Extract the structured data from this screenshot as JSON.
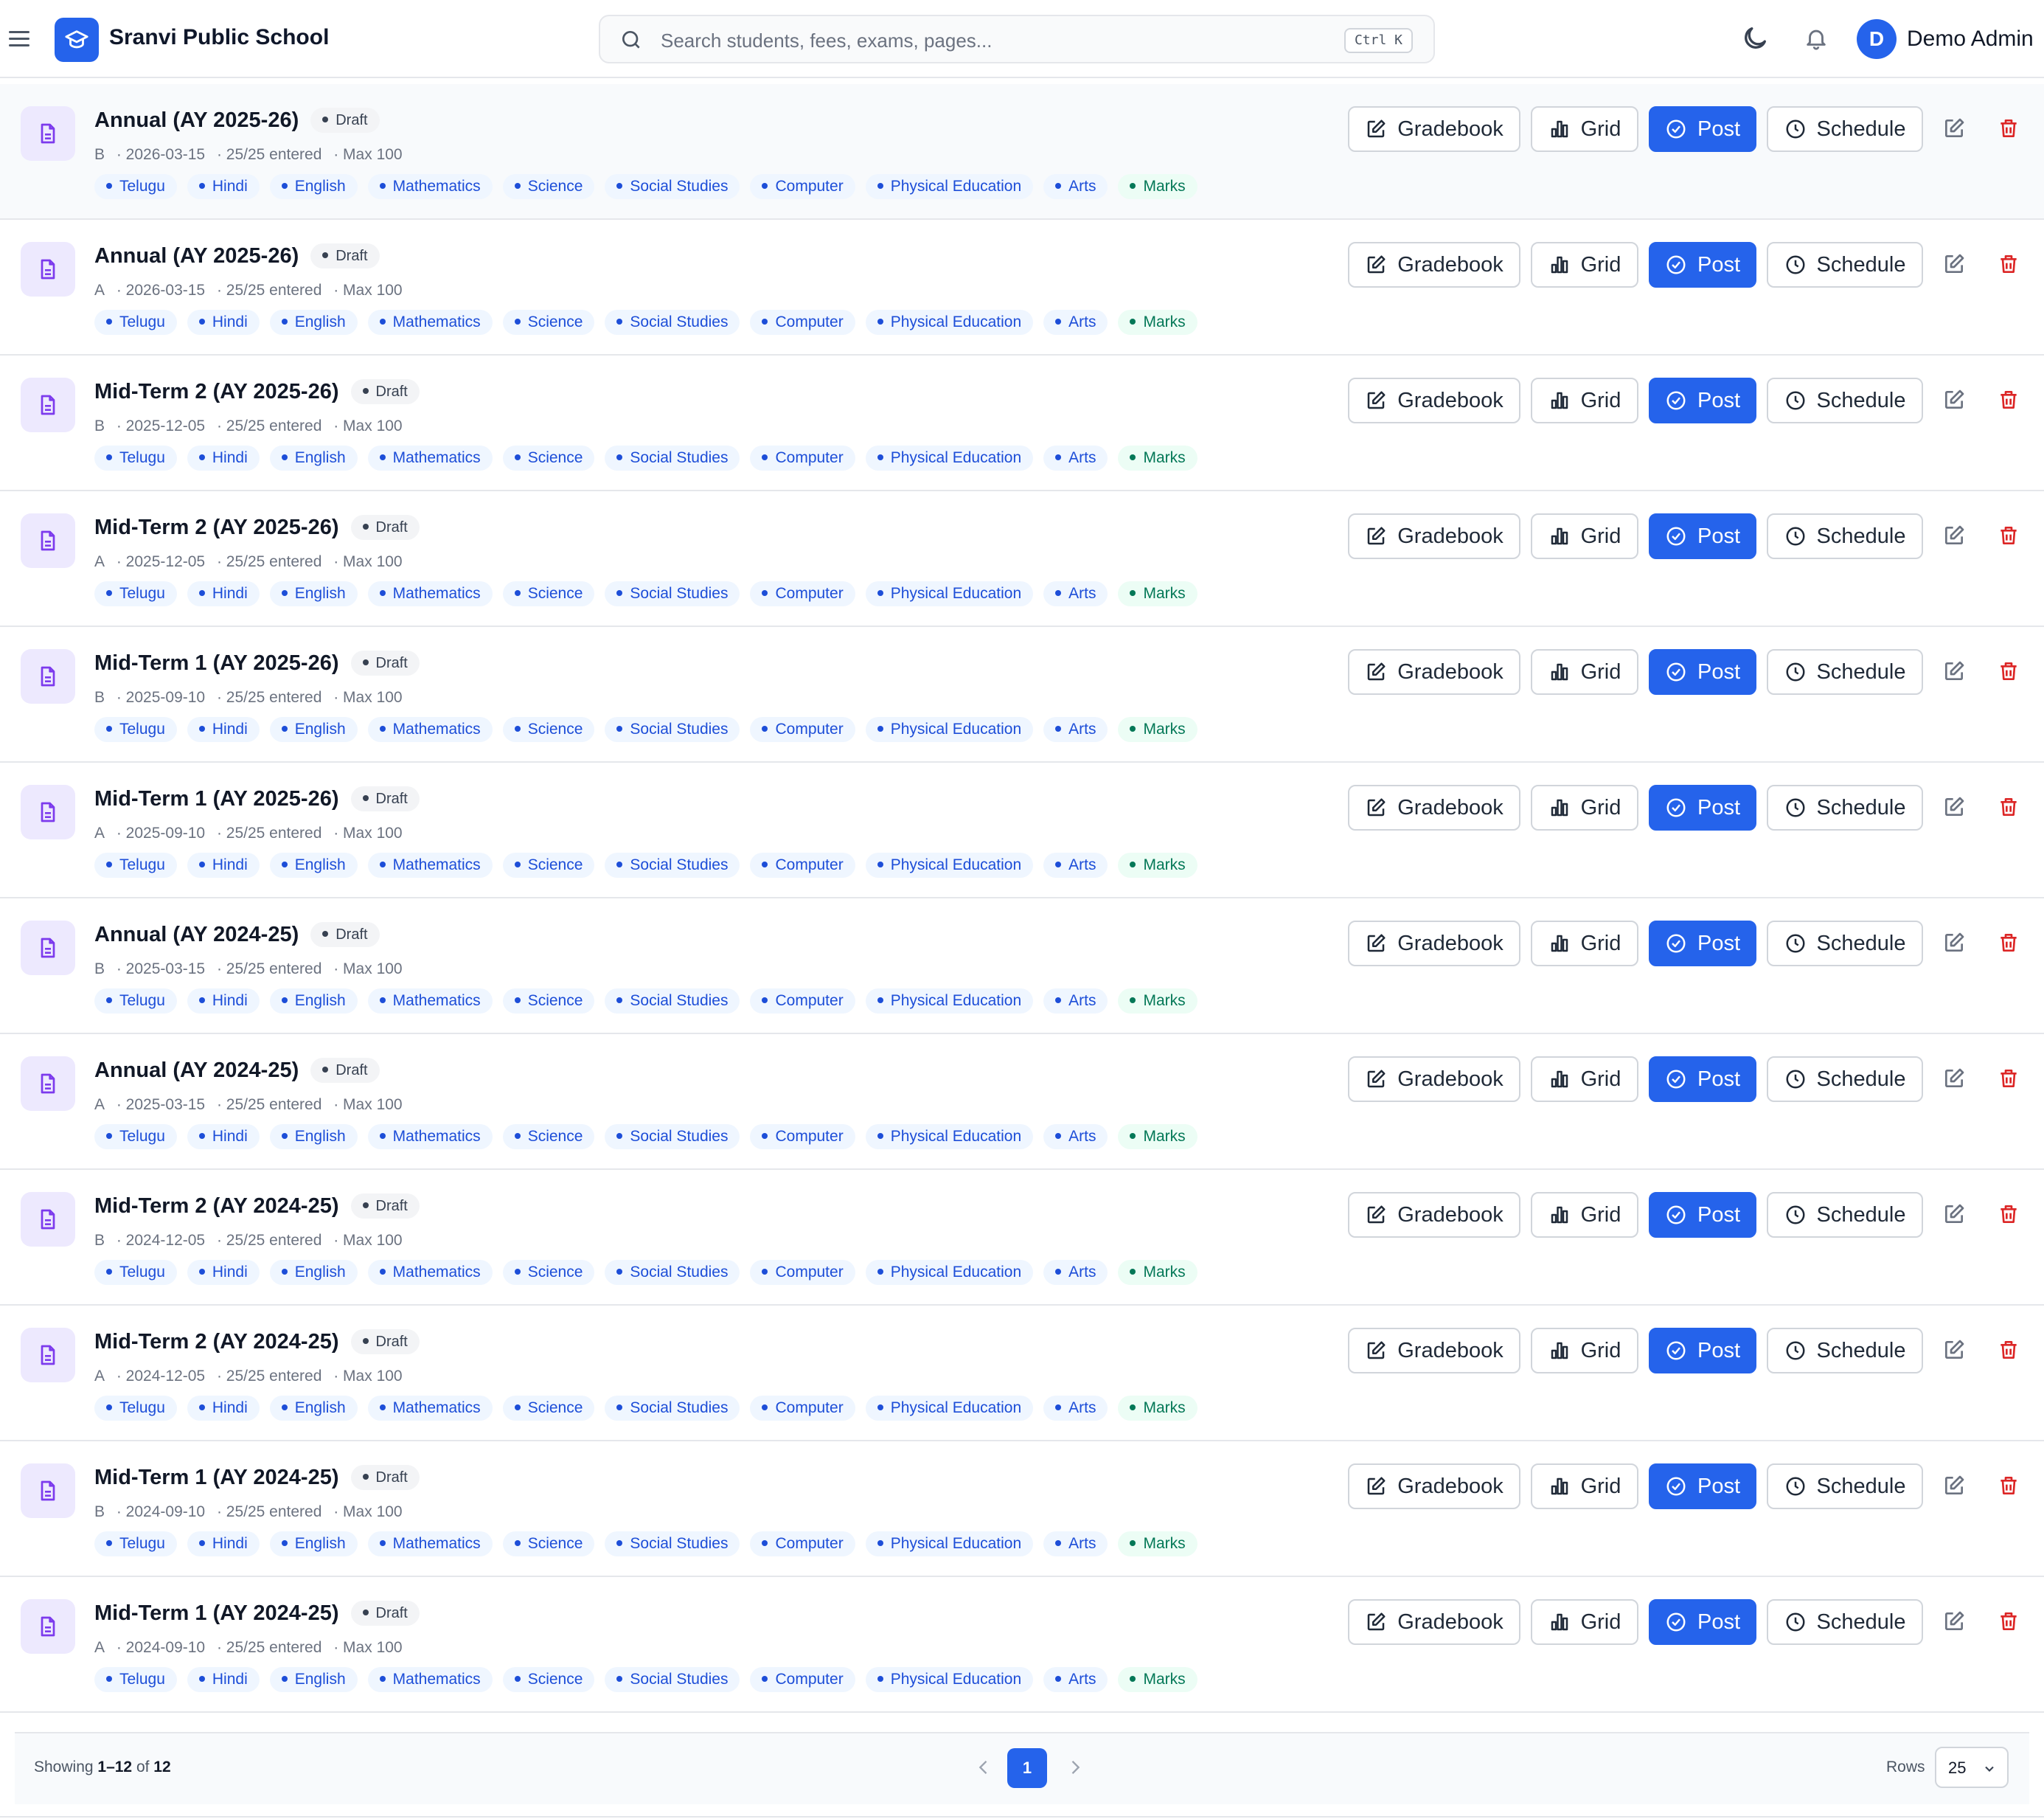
{
  "header": {
    "app_title": "Sranvi Public School",
    "search_placeholder": "Search students, fees, exams, pages...",
    "search_shortcut": "Ctrl K",
    "user_initial": "D",
    "user_name": "Demo Admin"
  },
  "colors": {
    "accent": "#2563eb",
    "danger": "#dc2626",
    "chip_blue": "#1d4ed8",
    "chip_green": "#047857",
    "icon_purple": "#7c3aed"
  },
  "icons": [
    "menu-icon",
    "logo-icon",
    "search-icon",
    "moon-icon",
    "bell-icon",
    "document-icon",
    "pencil-square-icon",
    "bar-chart-icon",
    "check-circle-icon",
    "clock-icon",
    "edit-icon",
    "trash-icon",
    "chevron-left-icon",
    "chevron-right-icon",
    "chevron-down-icon"
  ],
  "actions": {
    "gradebook": "Gradebook",
    "grid": "Grid",
    "post": "Post",
    "schedule": "Schedule"
  },
  "exams": [
    {
      "title": "Annual (AY 2025-26)",
      "status": "Draft",
      "section": "B",
      "date": "2026-03-15",
      "entered": "25/25 entered",
      "max": "Max 100"
    },
    {
      "title": "Annual (AY 2025-26)",
      "status": "Draft",
      "section": "A",
      "date": "2026-03-15",
      "entered": "25/25 entered",
      "max": "Max 100"
    },
    {
      "title": "Mid-Term 2 (AY 2025-26)",
      "status": "Draft",
      "section": "B",
      "date": "2025-12-05",
      "entered": "25/25 entered",
      "max": "Max 100"
    },
    {
      "title": "Mid-Term 2 (AY 2025-26)",
      "status": "Draft",
      "section": "A",
      "date": "2025-12-05",
      "entered": "25/25 entered",
      "max": "Max 100"
    },
    {
      "title": "Mid-Term 1 (AY 2025-26)",
      "status": "Draft",
      "section": "B",
      "date": "2025-09-10",
      "entered": "25/25 entered",
      "max": "Max 100"
    },
    {
      "title": "Mid-Term 1 (AY 2025-26)",
      "status": "Draft",
      "section": "A",
      "date": "2025-09-10",
      "entered": "25/25 entered",
      "max": "Max 100"
    },
    {
      "title": "Annual (AY 2024-25)",
      "status": "Draft",
      "section": "B",
      "date": "2025-03-15",
      "entered": "25/25 entered",
      "max": "Max 100"
    },
    {
      "title": "Annual (AY 2024-25)",
      "status": "Draft",
      "section": "A",
      "date": "2025-03-15",
      "entered": "25/25 entered",
      "max": "Max 100"
    },
    {
      "title": "Mid-Term 2 (AY 2024-25)",
      "status": "Draft",
      "section": "B",
      "date": "2024-12-05",
      "entered": "25/25 entered",
      "max": "Max 100"
    },
    {
      "title": "Mid-Term 2 (AY 2024-25)",
      "status": "Draft",
      "section": "A",
      "date": "2024-12-05",
      "entered": "25/25 entered",
      "max": "Max 100"
    },
    {
      "title": "Mid-Term 1 (AY 2024-25)",
      "status": "Draft",
      "section": "B",
      "date": "2024-09-10",
      "entered": "25/25 entered",
      "max": "Max 100"
    },
    {
      "title": "Mid-Term 1 (AY 2024-25)",
      "status": "Draft",
      "section": "A",
      "date": "2024-09-10",
      "entered": "25/25 entered",
      "max": "Max 100"
    }
  ],
  "subjects": [
    "Telugu",
    "Hindi",
    "English",
    "Mathematics",
    "Science",
    "Social Studies",
    "Computer",
    "Physical Education",
    "Arts"
  ],
  "marks_chip": "Marks",
  "footer": {
    "showing_prefix": "Showing ",
    "showing_range": "1–12",
    "showing_of": " of ",
    "showing_total": "12",
    "current_page": "1",
    "rows_label": "Rows",
    "rows_value": "25"
  }
}
